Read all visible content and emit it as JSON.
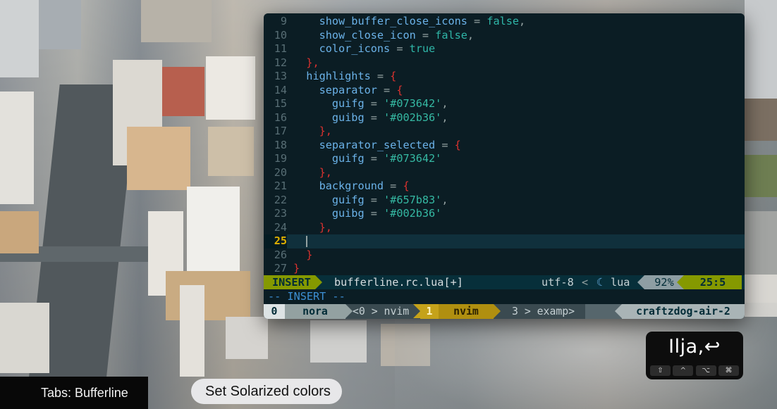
{
  "editor": {
    "lines": [
      {
        "num": "9",
        "tokens": [
          {
            "t": "    "
          },
          {
            "t": "show_buffer_close_icons",
            "c": "key"
          },
          {
            "t": " = ",
            "c": "op"
          },
          {
            "t": "false",
            "c": "bool"
          },
          {
            "t": ",",
            "c": "op"
          }
        ]
      },
      {
        "num": "10",
        "tokens": [
          {
            "t": "    "
          },
          {
            "t": "show_close_icon",
            "c": "key"
          },
          {
            "t": " = ",
            "c": "op"
          },
          {
            "t": "false",
            "c": "bool"
          },
          {
            "t": ",",
            "c": "op"
          }
        ]
      },
      {
        "num": "11",
        "tokens": [
          {
            "t": "    "
          },
          {
            "t": "color_icons",
            "c": "key"
          },
          {
            "t": " = ",
            "c": "op"
          },
          {
            "t": "true",
            "c": "bool"
          }
        ]
      },
      {
        "num": "12",
        "tokens": [
          {
            "t": "  "
          },
          {
            "t": "},",
            "c": "br"
          }
        ]
      },
      {
        "num": "13",
        "tokens": [
          {
            "t": "  "
          },
          {
            "t": "highlights",
            "c": "key"
          },
          {
            "t": " = ",
            "c": "op"
          },
          {
            "t": "{",
            "c": "br"
          }
        ]
      },
      {
        "num": "14",
        "tokens": [
          {
            "t": "    "
          },
          {
            "t": "separator",
            "c": "key"
          },
          {
            "t": " = ",
            "c": "op"
          },
          {
            "t": "{",
            "c": "br"
          }
        ]
      },
      {
        "num": "15",
        "tokens": [
          {
            "t": "      "
          },
          {
            "t": "guifg",
            "c": "key"
          },
          {
            "t": " = ",
            "c": "op"
          },
          {
            "t": "'#073642'",
            "c": "str"
          },
          {
            "t": ",",
            "c": "op"
          }
        ]
      },
      {
        "num": "16",
        "tokens": [
          {
            "t": "      "
          },
          {
            "t": "guibg",
            "c": "key"
          },
          {
            "t": " = ",
            "c": "op"
          },
          {
            "t": "'#002b36'",
            "c": "str"
          },
          {
            "t": ",",
            "c": "op"
          }
        ]
      },
      {
        "num": "17",
        "tokens": [
          {
            "t": "    "
          },
          {
            "t": "},",
            "c": "br"
          }
        ]
      },
      {
        "num": "18",
        "tokens": [
          {
            "t": "    "
          },
          {
            "t": "separator_selected",
            "c": "key"
          },
          {
            "t": " = ",
            "c": "op"
          },
          {
            "t": "{",
            "c": "br"
          }
        ]
      },
      {
        "num": "19",
        "tokens": [
          {
            "t": "      "
          },
          {
            "t": "guifg",
            "c": "key"
          },
          {
            "t": " = ",
            "c": "op"
          },
          {
            "t": "'#073642'",
            "c": "str"
          }
        ]
      },
      {
        "num": "20",
        "tokens": [
          {
            "t": "    "
          },
          {
            "t": "},",
            "c": "br"
          }
        ]
      },
      {
        "num": "21",
        "tokens": [
          {
            "t": "    "
          },
          {
            "t": "background",
            "c": "key"
          },
          {
            "t": " = ",
            "c": "op"
          },
          {
            "t": "{",
            "c": "br"
          }
        ]
      },
      {
        "num": "22",
        "tokens": [
          {
            "t": "      "
          },
          {
            "t": "guifg",
            "c": "key"
          },
          {
            "t": " = ",
            "c": "op"
          },
          {
            "t": "'#657b83'",
            "c": "str"
          },
          {
            "t": ",",
            "c": "op"
          }
        ]
      },
      {
        "num": "23",
        "tokens": [
          {
            "t": "      "
          },
          {
            "t": "guibg",
            "c": "key"
          },
          {
            "t": " = ",
            "c": "op"
          },
          {
            "t": "'#002b36'",
            "c": "str"
          }
        ]
      },
      {
        "num": "24",
        "tokens": [
          {
            "t": "    "
          },
          {
            "t": "},",
            "c": "br"
          }
        ]
      },
      {
        "num": "25",
        "current": true,
        "tokens": [
          {
            "t": "  "
          }
        ]
      },
      {
        "num": "26",
        "tokens": [
          {
            "t": "  "
          },
          {
            "t": "}",
            "c": "br"
          }
        ]
      },
      {
        "num": "27",
        "tokens": [
          {
            "t": "}",
            "c": "br"
          }
        ]
      }
    ]
  },
  "statusline": {
    "mode": "INSERT",
    "filename": "bufferline.rc.lua[+]",
    "encoding": "utf-8",
    "separator": "<",
    "filetype_icon": "lua-icon",
    "filetype": "lua",
    "percent": "92%",
    "position": "25:5"
  },
  "message": "-- INSERT --",
  "tmux": {
    "session_index": "0",
    "session_name": "nora",
    "window1": "<0 > nvim",
    "window2_index": "1",
    "window2_name": "nvim",
    "window3": "3 > examp>",
    "hostname": "craftzdog-air-2"
  },
  "keycast": {
    "text": "Ilja,↩",
    "modifiers": [
      "⇧",
      "^",
      "⌥",
      "⌘"
    ]
  },
  "overlay": {
    "chapter": "Tabs: Bufferline",
    "caption": "Set Solarized colors"
  },
  "colors": {
    "terminal_bg": "#0b1d24",
    "mode_bg": "#859900",
    "string": "#35b9a3",
    "keyword": "#6bb2e8",
    "bracket": "#dc322f"
  }
}
